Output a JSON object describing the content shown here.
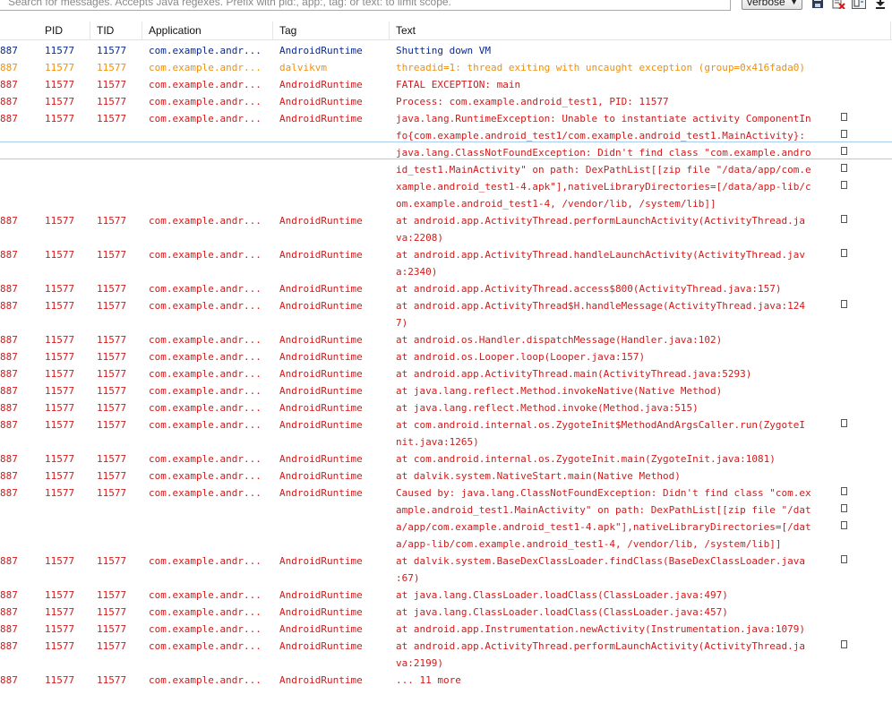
{
  "search": {
    "placeholder": "Search for messages. Accepts Java regexes. Prefix with pid:, app:, tag: or text: to limit scope."
  },
  "level": {
    "selected": "verbose"
  },
  "toolbar": {
    "icons": [
      "save-icon",
      "clear-log-icon",
      "toggle-view-icon",
      "scroll-lock-icon"
    ]
  },
  "columns": {
    "pid": "PID",
    "tid": "TID",
    "app": "Application",
    "tag": "Tag",
    "text": "Text"
  },
  "colors": {
    "error": "#d21a1a",
    "warn": "#f0900a",
    "debug": "#0a2a8c",
    "selected": "#e8f2fb"
  },
  "rows": [
    {
      "level": "blue",
      "pidcut": "887",
      "pid": "11577",
      "tid": "11577",
      "app": "com.example.andr...",
      "tag": "AndroidRuntime",
      "lines": [
        "Shutting down VM"
      ]
    },
    {
      "level": "orange",
      "pidcut": "887",
      "pid": "11577",
      "tid": "11577",
      "app": "com.example.andr...",
      "tag": "dalvikvm",
      "lines": [
        "threadid=1: thread exiting with uncaught exception (group=0x416fada0)"
      ]
    },
    {
      "level": "red",
      "pidcut": "887",
      "pid": "11577",
      "tid": "11577",
      "app": "com.example.andr...",
      "tag": "AndroidRuntime",
      "lines": [
        "FATAL EXCEPTION: main"
      ]
    },
    {
      "level": "red",
      "pidcut": "887",
      "pid": "11577",
      "tid": "11577",
      "app": "com.example.andr...",
      "tag": "AndroidRuntime",
      "lines": [
        "Process: com.example.android_test1, PID: 11577"
      ]
    },
    {
      "level": "red",
      "pidcut": "887",
      "pid": "11577",
      "tid": "11577",
      "app": "com.example.andr...",
      "tag": "AndroidRuntime",
      "lines": [
        "java.lang.RuntimeException: Unable to instantiate activity ComponentIn",
        "fo{com.example.android_test1/com.example.android_test1.MainActivity}:",
        "java.lang.ClassNotFoundException: Didn't find class \"com.example.andro",
        "id_test1.MainActivity\" on path: DexPathList[[zip file \"/data/app/com.e",
        "xample.android_test1-4.apk\"],nativeLibraryDirectories=[/data/app-lib/c",
        "om.example.android_test1-4, /vendor/lib, /system/lib]]"
      ],
      "wraps": [
        true,
        true,
        true,
        true,
        true,
        false
      ]
    },
    {
      "level": "red",
      "pidcut": "887",
      "pid": "11577",
      "tid": "11577",
      "app": "com.example.andr...",
      "tag": "AndroidRuntime",
      "lines": [
        "at android.app.ActivityThread.performLaunchActivity(ActivityThread.ja",
        "va:2208)"
      ],
      "wraps": [
        true,
        false
      ]
    },
    {
      "level": "red",
      "pidcut": "887",
      "pid": "11577",
      "tid": "11577",
      "app": "com.example.andr...",
      "tag": "AndroidRuntime",
      "lines": [
        "at android.app.ActivityThread.handleLaunchActivity(ActivityThread.jav",
        "a:2340)"
      ],
      "wraps": [
        true,
        false
      ]
    },
    {
      "level": "red",
      "pidcut": "887",
      "pid": "11577",
      "tid": "11577",
      "app": "com.example.andr...",
      "tag": "AndroidRuntime",
      "lines": [
        "at android.app.ActivityThread.access$800(ActivityThread.java:157)"
      ]
    },
    {
      "level": "red",
      "pidcut": "887",
      "pid": "11577",
      "tid": "11577",
      "app": "com.example.andr...",
      "tag": "AndroidRuntime",
      "lines": [
        "at android.app.ActivityThread$H.handleMessage(ActivityThread.java:124",
        "7)"
      ],
      "wraps": [
        true,
        false
      ]
    },
    {
      "level": "red",
      "pidcut": "887",
      "pid": "11577",
      "tid": "11577",
      "app": "com.example.andr...",
      "tag": "AndroidRuntime",
      "lines": [
        "at android.os.Handler.dispatchMessage(Handler.java:102)"
      ]
    },
    {
      "level": "red",
      "pidcut": "887",
      "pid": "11577",
      "tid": "11577",
      "app": "com.example.andr...",
      "tag": "AndroidRuntime",
      "lines": [
        "at android.os.Looper.loop(Looper.java:157)"
      ]
    },
    {
      "level": "red",
      "pidcut": "887",
      "pid": "11577",
      "tid": "11577",
      "app": "com.example.andr...",
      "tag": "AndroidRuntime",
      "lines": [
        "at android.app.ActivityThread.main(ActivityThread.java:5293)"
      ]
    },
    {
      "level": "red",
      "pidcut": "887",
      "pid": "11577",
      "tid": "11577",
      "app": "com.example.andr...",
      "tag": "AndroidRuntime",
      "lines": [
        "at java.lang.reflect.Method.invokeNative(Native Method)"
      ]
    },
    {
      "level": "red",
      "pidcut": "887",
      "pid": "11577",
      "tid": "11577",
      "app": "com.example.andr...",
      "tag": "AndroidRuntime",
      "lines": [
        "at java.lang.reflect.Method.invoke(Method.java:515)"
      ]
    },
    {
      "level": "red",
      "pidcut": "887",
      "pid": "11577",
      "tid": "11577",
      "app": "com.example.andr...",
      "tag": "AndroidRuntime",
      "lines": [
        "at com.android.internal.os.ZygoteInit$MethodAndArgsCaller.run(ZygoteI",
        "nit.java:1265)"
      ],
      "wraps": [
        true,
        false
      ]
    },
    {
      "level": "red",
      "pidcut": "887",
      "pid": "11577",
      "tid": "11577",
      "app": "com.example.andr...",
      "tag": "AndroidRuntime",
      "lines": [
        "at com.android.internal.os.ZygoteInit.main(ZygoteInit.java:1081)"
      ]
    },
    {
      "level": "red",
      "pidcut": "887",
      "pid": "11577",
      "tid": "11577",
      "app": "com.example.andr...",
      "tag": "AndroidRuntime",
      "lines": [
        "at dalvik.system.NativeStart.main(Native Method)"
      ]
    },
    {
      "level": "red",
      "pidcut": "887",
      "pid": "11577",
      "tid": "11577",
      "app": "com.example.andr...",
      "tag": "AndroidRuntime",
      "lines": [
        "Caused by: java.lang.ClassNotFoundException: Didn't find class \"com.ex",
        "ample.android_test1.MainActivity\" on path: DexPathList[[zip file \"/dat",
        "a/app/com.example.android_test1-4.apk\"],nativeLibraryDirectories=[/dat",
        "a/app-lib/com.example.android_test1-4, /vendor/lib, /system/lib]]"
      ],
      "wraps": [
        true,
        true,
        true,
        false
      ]
    },
    {
      "level": "red",
      "pidcut": "887",
      "pid": "11577",
      "tid": "11577",
      "app": "com.example.andr...",
      "tag": "AndroidRuntime",
      "lines": [
        "at dalvik.system.BaseDexClassLoader.findClass(BaseDexClassLoader.java",
        ":67)"
      ],
      "wraps": [
        true,
        false
      ]
    },
    {
      "level": "red",
      "pidcut": "887",
      "pid": "11577",
      "tid": "11577",
      "app": "com.example.andr...",
      "tag": "AndroidRuntime",
      "lines": [
        "at java.lang.ClassLoader.loadClass(ClassLoader.java:497)"
      ]
    },
    {
      "level": "red",
      "pidcut": "887",
      "pid": "11577",
      "tid": "11577",
      "app": "com.example.andr...",
      "tag": "AndroidRuntime",
      "lines": [
        "at java.lang.ClassLoader.loadClass(ClassLoader.java:457)"
      ]
    },
    {
      "level": "red",
      "pidcut": "887",
      "pid": "11577",
      "tid": "11577",
      "app": "com.example.andr...",
      "tag": "AndroidRuntime",
      "lines": [
        "at android.app.Instrumentation.newActivity(Instrumentation.java:1079)"
      ]
    },
    {
      "level": "red",
      "pidcut": "887",
      "pid": "11577",
      "tid": "11577",
      "app": "com.example.andr...",
      "tag": "AndroidRuntime",
      "lines": [
        "at android.app.ActivityThread.performLaunchActivity(ActivityThread.ja",
        "va:2199)"
      ],
      "wraps": [
        true,
        false
      ]
    },
    {
      "level": "red",
      "pidcut": "887",
      "pid": "11577",
      "tid": "11577",
      "app": "com.example.andr...",
      "tag": "AndroidRuntime",
      "lines": [
        "... 11 more"
      ]
    }
  ]
}
